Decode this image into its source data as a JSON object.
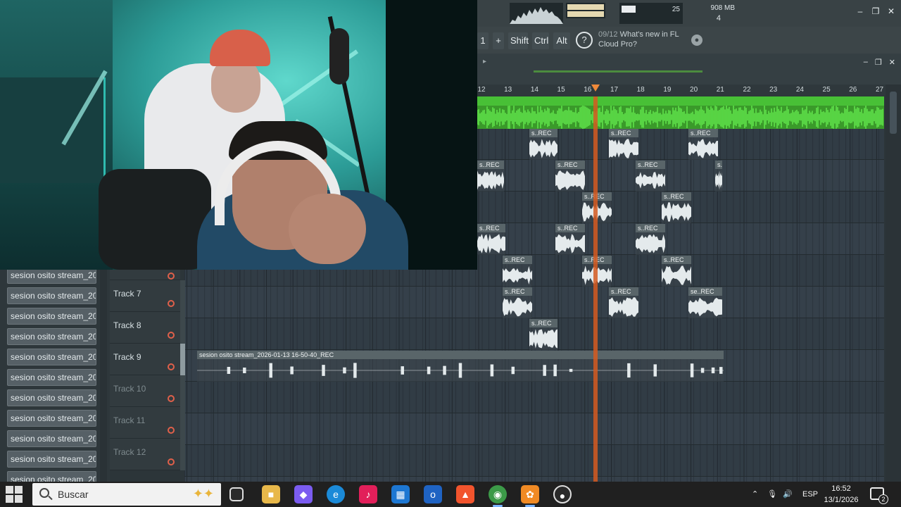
{
  "flstudio": {
    "cpu_value": "25",
    "memory": "908 MB",
    "polyphony": "4",
    "keys": [
      "Shift",
      "Ctrl",
      "Alt"
    ],
    "news_counter": "09/12",
    "news_text": "What's new in FL Cloud Pro?",
    "pattern_number": "1"
  },
  "ruler": {
    "bars": [
      "12",
      "13",
      "14",
      "15",
      "16",
      "17",
      "18",
      "19",
      "20",
      "21",
      "22",
      "23",
      "24",
      "25",
      "26",
      "27"
    ]
  },
  "tracks": [
    {
      "name": "Track 7",
      "dim": false
    },
    {
      "name": "Track 8",
      "dim": false
    },
    {
      "name": "Track 9",
      "dim": false
    },
    {
      "name": "Track 10",
      "dim": true
    },
    {
      "name": "Track 11",
      "dim": true
    },
    {
      "name": "Track 12",
      "dim": true
    }
  ],
  "browser": {
    "items": [
      "sesion osito stream_202...",
      "sesion osito stream_202...",
      "sesion osito stream_202...",
      "sesion osito stream_202...",
      "sesion osito stream_202...",
      "sesion osito stream_202...",
      "sesion osito stream_202...",
      "sesion osito stream_202...",
      "sesion osito stream_202...",
      "sesion osito stream_202...",
      "sesion osito stream_202..."
    ]
  },
  "clips": {
    "short": "s..REC",
    "short_alt": "se..REC",
    "long": "sesion osito stream_2026-01-13 16-50-40_REC"
  },
  "taskbar": {
    "search_placeholder": "Buscar",
    "language": "ESP",
    "time": "16:52",
    "date": "13/1/2026",
    "notifications": "2"
  },
  "colors": {
    "master_wave": "#48c036",
    "playhead": "#d55a21",
    "record": "#e0604a"
  }
}
